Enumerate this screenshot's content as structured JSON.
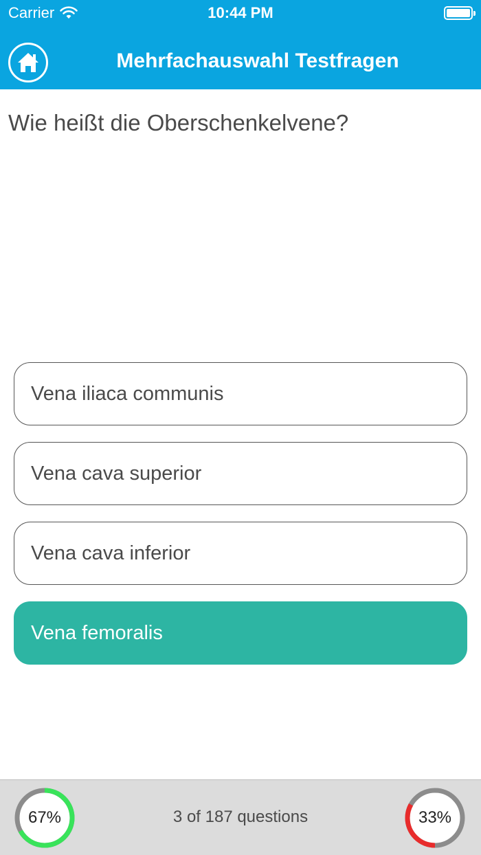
{
  "status_bar": {
    "carrier": "Carrier",
    "time": "10:44 PM"
  },
  "nav": {
    "title": "Mehrfachauswahl Testfragen",
    "home_icon": "home-icon"
  },
  "question": "Wie heißt die Oberschenkelvene?",
  "answers": [
    {
      "label": "Vena iliaca communis",
      "state": "default"
    },
    {
      "label": "Vena cava superior",
      "state": "default"
    },
    {
      "label": "Vena cava inferior",
      "state": "default"
    },
    {
      "label": "Vena femoralis",
      "state": "correct"
    }
  ],
  "footer": {
    "progress_text": "3 of 187 questions",
    "correct_percent_label": "67%",
    "correct_percent": 67,
    "wrong_percent_label": "33%",
    "wrong_percent": 33
  },
  "colors": {
    "header": "#0aa5e0",
    "correct_answer": "#2db5a3",
    "ring_correct": "#39e35a",
    "ring_wrong": "#e82c2c",
    "ring_track": "#8c8c8c"
  }
}
